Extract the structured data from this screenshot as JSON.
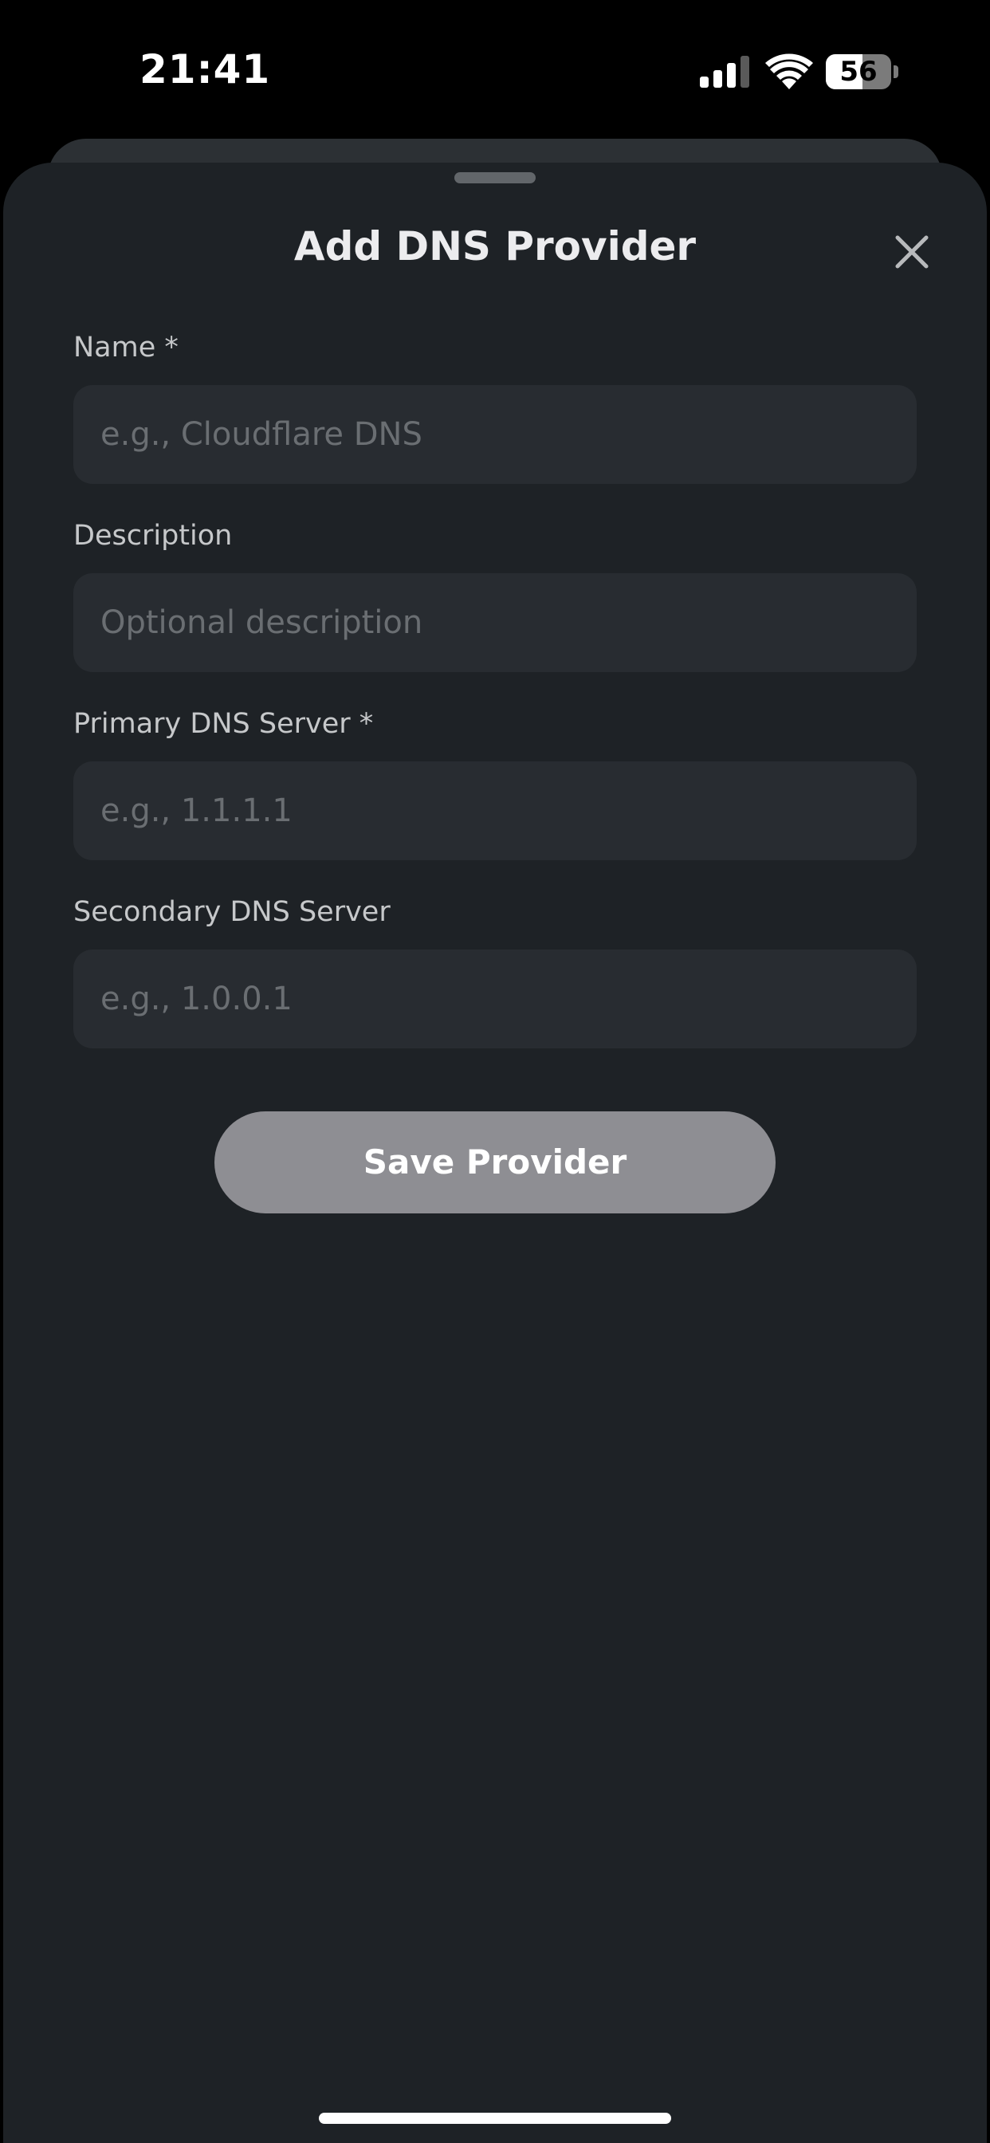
{
  "status_bar": {
    "time": "21:41",
    "battery_level": "56",
    "battery_fraction": 0.56,
    "signal_icon": "cellular-signal-icon",
    "wifi_icon": "wifi-icon"
  },
  "sheet": {
    "title": "Add DNS Provider",
    "close_icon": "close-icon"
  },
  "form": {
    "name": {
      "label": "Name *",
      "placeholder": "e.g., Cloudflare DNS",
      "value": ""
    },
    "description": {
      "label": "Description",
      "placeholder": "Optional description",
      "value": ""
    },
    "primary_dns": {
      "label": "Primary DNS Server *",
      "placeholder": "e.g., 1.1.1.1",
      "value": ""
    },
    "secondary_dns": {
      "label": "Secondary DNS Server",
      "placeholder": "e.g., 1.0.0.1",
      "value": ""
    },
    "save_label": "Save Provider"
  },
  "colors": {
    "sheet_background": "#1e2226",
    "input_background": "#282c31",
    "button_disabled": "#8e8e93",
    "label_text": "#c6c8ca",
    "placeholder_text": "#6a6e72"
  }
}
